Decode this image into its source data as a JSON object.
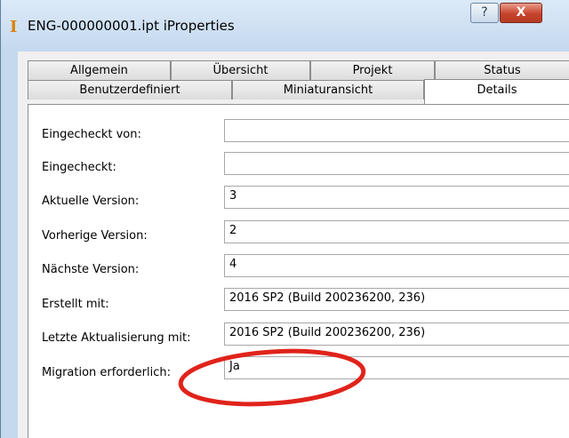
{
  "window": {
    "title": "ENG-000000001.ipt iProperties",
    "app_icon": "inventor-part-icon",
    "help_label": "?",
    "close_label": "X"
  },
  "tabs": {
    "row1": [
      "Allgemein",
      "Übersicht",
      "Projekt",
      "Status"
    ],
    "row2": [
      "Benutzerdefiniert",
      "Miniaturansicht",
      "Details"
    ],
    "active": "Details"
  },
  "fields": [
    {
      "label": "Eingecheckt von:",
      "value": ""
    },
    {
      "label": "Eingecheckt:",
      "value": ""
    },
    {
      "label": "Aktuelle Version:",
      "value": "3"
    },
    {
      "label": "Vorherige Version:",
      "value": "2"
    },
    {
      "label": "Nächste Version:",
      "value": "4"
    },
    {
      "label": "Erstellt mit:",
      "value": "2016 SP2 (Build 200236200, 236)"
    },
    {
      "label": "Letzte Aktualisierung mit:",
      "value": "2016 SP2 (Build 200236200, 236)"
    },
    {
      "label": "Migration erforderlich:",
      "value": "Ja"
    }
  ],
  "colors": {
    "accent_ring": "#e0231b",
    "close_button": "#c7432b"
  }
}
